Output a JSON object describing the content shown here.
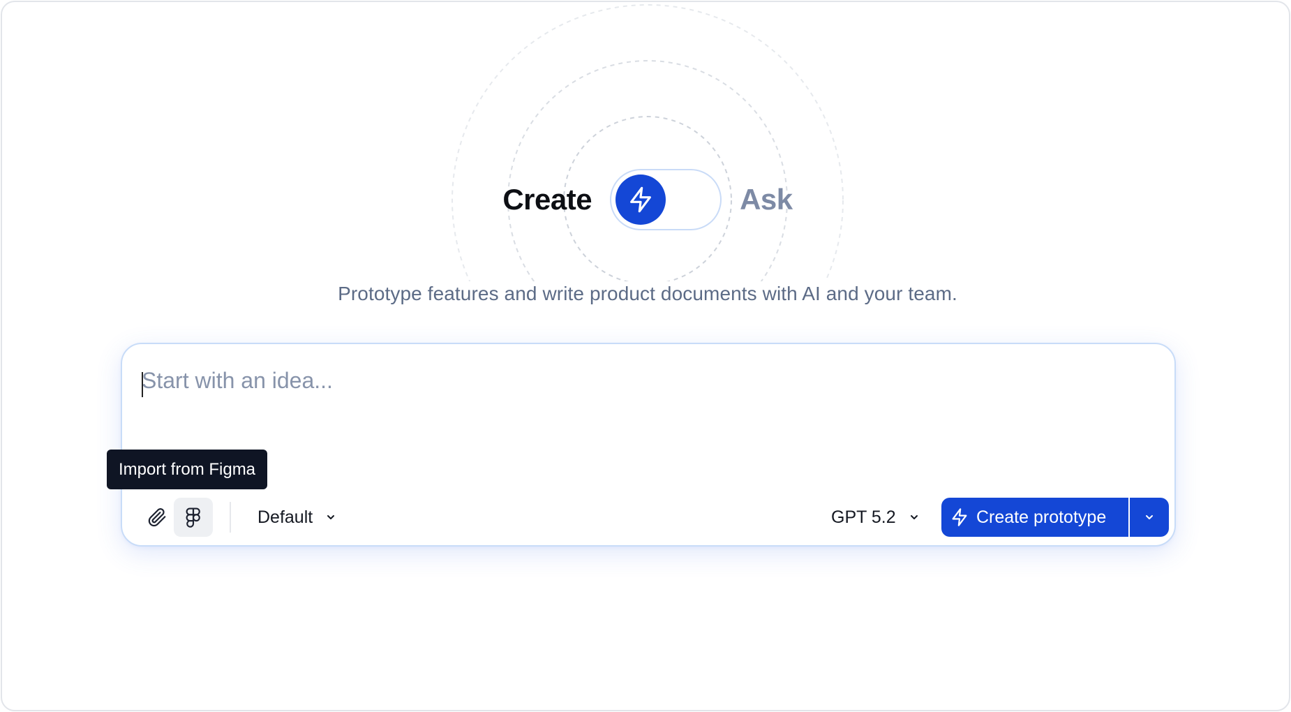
{
  "mode_switch": {
    "left_label": "Create",
    "right_label": "Ask",
    "active_mode": "Create",
    "knob_icon": "lightning-bolt-icon"
  },
  "subtitle": "Prototype features and write product documents with AI and your team.",
  "composer": {
    "input_value": "",
    "input_placeholder": "Start with an idea...",
    "attach_icon": "paperclip-icon",
    "figma_icon": "figma-icon",
    "style_select": "Default",
    "model_select": "GPT 5.2",
    "submit_label": "Create prototype",
    "submit_icon": "lightning-bolt-icon",
    "submit_menu_icon": "chevron-down-icon"
  },
  "tooltip": {
    "text": "Import from Figma"
  },
  "colors": {
    "accent": "#1447d6",
    "muted_text": "#5c6b86",
    "ask_label": "#7d8aa5",
    "tooltip_bg": "#0f1524",
    "composer_border": "#c8dcf8"
  }
}
